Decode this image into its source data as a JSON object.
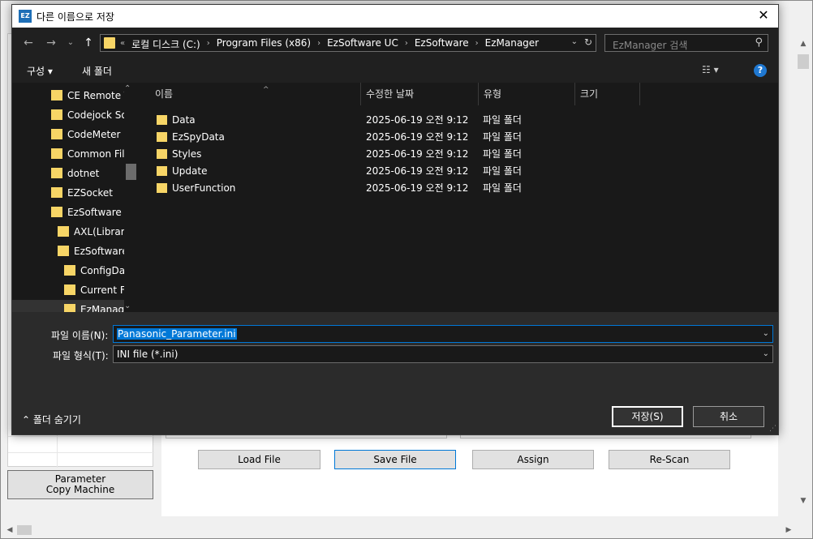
{
  "app": {
    "buttons": {
      "load": "Load File",
      "save": "Save File",
      "assign": "Assign",
      "rescan": "Re-Scan"
    },
    "param_copy_line1": "Parameter",
    "param_copy_line2": "Copy Machine"
  },
  "dialog": {
    "title": "다른 이름으로 저장",
    "icon_text": "EZ",
    "close_symbol": "✕",
    "nav": {
      "back": "←",
      "forward": "→",
      "recent": "⌄",
      "up": "↑"
    },
    "breadcrumbs": [
      "로컬 디스크 (C:)",
      "Program Files (x86)",
      "EzSoftware UC",
      "EzSoftware",
      "EzManager"
    ],
    "breadcrumb_prefix": "«",
    "search_placeholder": "EzManager 검색",
    "toolbar": {
      "organize": "구성 ▾",
      "new_folder": "새 폴더",
      "view_icon": "☷ ▾",
      "help": "?"
    },
    "tree": [
      {
        "label": "CE Remote T",
        "selected": false
      },
      {
        "label": "Codejock So",
        "selected": false
      },
      {
        "label": "CodeMeter",
        "selected": false
      },
      {
        "label": "Common File",
        "selected": false
      },
      {
        "label": "dotnet",
        "selected": false
      },
      {
        "label": "EZSocket",
        "selected": false
      },
      {
        "label": "EzSoftware U",
        "selected": false
      },
      {
        "label": "AXL(Library",
        "selected": false
      },
      {
        "label": "EzSoftware",
        "selected": false
      },
      {
        "label": "ConfigData",
        "selected": false
      },
      {
        "label": "Current Fi",
        "selected": false
      },
      {
        "label": "EzManager",
        "selected": true
      }
    ],
    "columns": {
      "name": "이름",
      "date": "수정한 날짜",
      "type": "유형",
      "size": "크기"
    },
    "files": [
      {
        "name": "Data",
        "date": "2025-06-19 오전 9:12",
        "type": "파일 폴더"
      },
      {
        "name": "EzSpyData",
        "date": "2025-06-19 오전 9:12",
        "type": "파일 폴더"
      },
      {
        "name": "Styles",
        "date": "2025-06-19 오전 9:12",
        "type": "파일 폴더"
      },
      {
        "name": "Update",
        "date": "2025-06-19 오전 9:12",
        "type": "파일 폴더"
      },
      {
        "name": "UserFunction",
        "date": "2025-06-19 오전 9:12",
        "type": "파일 폴더"
      }
    ],
    "filename_label": "파일 이름(N):",
    "filename_value": "Panasonic_Parameter.ini",
    "filetype_label": "파일 형식(T):",
    "filetype_value": "INI file (*.ini)",
    "hide_folders": "⌃  폴더 숨기기",
    "save_button": "저장(S)",
    "cancel_button": "취소"
  }
}
